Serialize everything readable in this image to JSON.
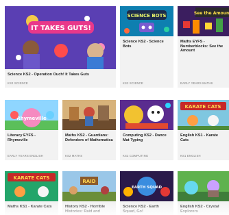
{
  "cards": [
    {
      "id": "operation-ouch",
      "title": "Science KS2 - Operation Ouch! It Takes Guts",
      "subject": "KS2 SCIENCE",
      "thumb_text": "IT TAKES GUTS!"
    },
    {
      "id": "science-bots",
      "title": "Science KS2 - Science Bots",
      "subject": "KS2 SCIENCE",
      "thumb_text": "SCIENCE BOTS"
    },
    {
      "id": "numberblocks",
      "title": "Maths EYFS - Numberblocks: See the Amount",
      "subject": "EARLY YEARS MATHS",
      "thumb_text": "See the Amount"
    },
    {
      "id": "rhymeville",
      "title": "Literacy EYFS - Rhymeville",
      "subject": "EARLY YEARS ENGLISH",
      "thumb_text": "Rhymeville"
    },
    {
      "id": "guardians-mathematica",
      "title": "Maths KS2 - Guardians: Defenders of Mathematica",
      "subject": "KS2 MATHS",
      "thumb_text": ""
    },
    {
      "id": "dance-mat-typing",
      "title": "Computing KS2 - Dance Mat Typing",
      "subject": "KS2 COMPUTING",
      "thumb_text": ""
    },
    {
      "id": "karate-cats-english",
      "title": "English KS1 - Karate Cats",
      "subject": "KS1 ENGLISH",
      "thumb_text": "KARATE CATS"
    },
    {
      "id": "karate-cats-maths",
      "title": "Maths KS1 - Karate Cats",
      "subject": "",
      "thumb_text": "KARATE CATS"
    },
    {
      "id": "horrible-histories",
      "title": "History KS2 - Horrible Histories: Raid and",
      "subject": "",
      "thumb_text": "RAID"
    },
    {
      "id": "earth-squad",
      "title": "Science KS2 - Earth Squad, Go!",
      "subject": "",
      "thumb_text": "EARTH SQUAD"
    },
    {
      "id": "crystal-explorers",
      "title": "English KS2 - Crystal Explorers",
      "subject": "",
      "thumb_text": ""
    }
  ],
  "colors": {
    "card_bg": "#f2f2f2",
    "title": "#222222",
    "subject": "#777777"
  }
}
